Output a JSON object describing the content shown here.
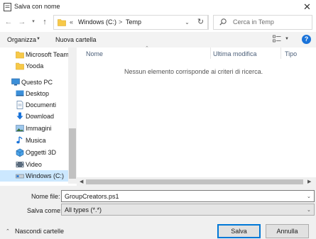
{
  "window": {
    "title": "Salva con nome"
  },
  "address": {
    "chevron": "«",
    "path": [
      "Windows (C:)",
      "Temp"
    ],
    "separator": ">"
  },
  "search": {
    "placeholder": "Cerca in Temp"
  },
  "toolbar": {
    "organize_label": "Organizza",
    "new_folder_label": "Nuova cartella"
  },
  "nav_pane": {
    "items": [
      {
        "label": "Microsoft Teams",
        "icon": "folder-icon"
      },
      {
        "label": "Yooda",
        "icon": "folder-icon"
      },
      {
        "label": "Questo PC",
        "icon": "computer-icon"
      },
      {
        "label": "Desktop",
        "icon": "desktop-icon"
      },
      {
        "label": "Documenti",
        "icon": "documents-icon"
      },
      {
        "label": "Download",
        "icon": "download-icon"
      },
      {
        "label": "Immagini",
        "icon": "pictures-icon"
      },
      {
        "label": "Musica",
        "icon": "music-icon"
      },
      {
        "label": "Oggetti 3D",
        "icon": "objects-3d-icon"
      },
      {
        "label": "Video",
        "icon": "video-icon"
      },
      {
        "label": "Windows (C:)",
        "icon": "drive-icon",
        "selected": true
      }
    ]
  },
  "columns": {
    "name": "Nome",
    "modified": "Ultima modifica",
    "type": "Tipo"
  },
  "content": {
    "empty_message": "Nessun elemento corrisponde ai criteri di ricerca."
  },
  "form": {
    "filename_label": "Nome file:",
    "filename_value": "GroupCreators.ps1",
    "savetype_label": "Salva come:",
    "savetype_value": "All types (*.*)"
  },
  "footer": {
    "hide_folders_label": "Nascondi cartelle",
    "save_label": "Salva",
    "cancel_label": "Annulla"
  },
  "colors": {
    "accent": "#0078d7",
    "selection": "#cce8ff",
    "help": "#1a73d9",
    "folder": "#f7c948"
  }
}
